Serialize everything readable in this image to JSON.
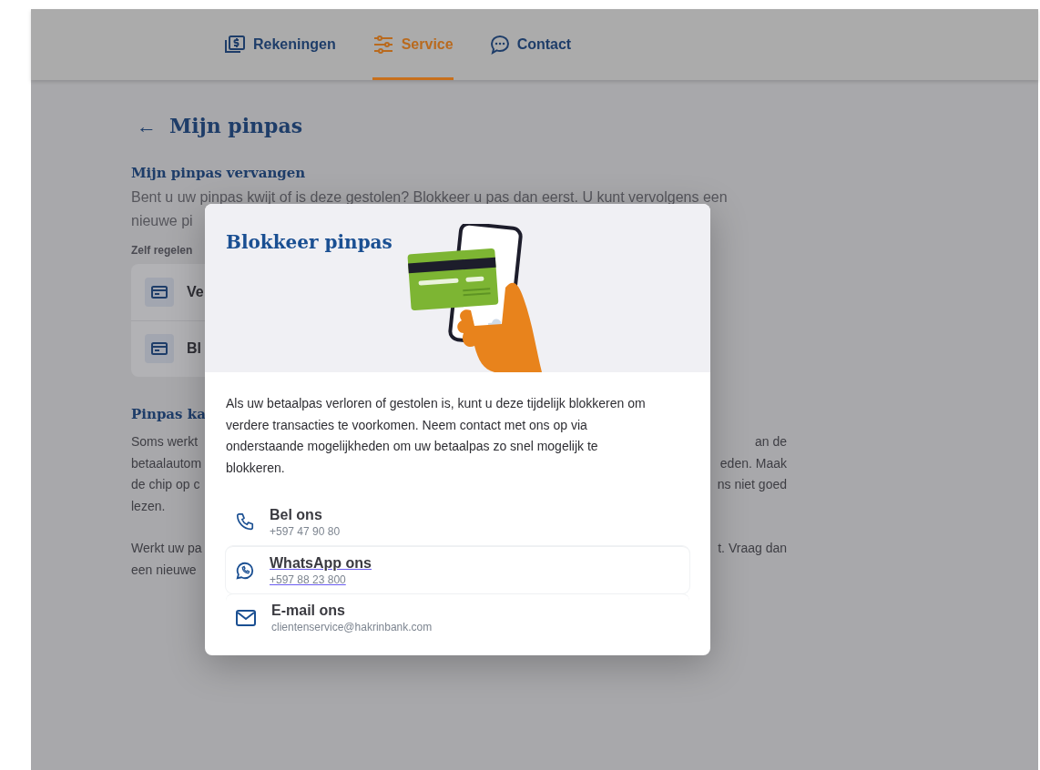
{
  "nav": {
    "tabs": [
      {
        "label": "Rekeningen",
        "kind": "accounts",
        "selected": false
      },
      {
        "label": "Service",
        "kind": "service",
        "selected": true
      },
      {
        "label": "Contact",
        "kind": "contact",
        "selected": false
      }
    ]
  },
  "page": {
    "back_arrow": "←",
    "title": "Mijn pinpas",
    "section_title": "Mijn pinpas vervangen",
    "intro_lines": [
      "Bent u uw pinpas kwijt of is deze gestolen? Blokkeer u pas dan eerst. U kunt vervolgens een",
      "nieuwe pi"
    ],
    "group_label": "Zelf regelen",
    "actions": [
      "Ve",
      "Bl"
    ],
    "section2_title": "Pinpas ka",
    "paragraphs": [
      [
        {
          "left": "Soms werkt",
          "right": "an de"
        },
        {
          "left": "betaalautom",
          "right": "eden. Maak"
        },
        {
          "left": "de chip op c",
          "right": "ns niet goed"
        },
        {
          "left": "lezen."
        }
      ],
      [
        {
          "left": "Werkt uw pa",
          "right": "t. Vraag dan"
        },
        {
          "left": "een nieuwe"
        }
      ]
    ]
  },
  "modal": {
    "title": "Blokkeer pinpas",
    "text": "Als uw betaalpas verloren of gestolen is, kunt u deze tijdelijk blokkeren om verdere transacties te voorkomen. Neem contact met ons op via onderstaande mogelijkheden om uw betaalpas zo snel mogelijk te blokkeren.",
    "contacts": [
      {
        "kind": "phone",
        "title": "Bel ons",
        "detail": "+597 47 90 80",
        "hovered": false
      },
      {
        "kind": "whatsapp",
        "title": "WhatsApp ons",
        "detail": "+597 88 23 800",
        "hovered": true
      },
      {
        "kind": "email",
        "title": "E-mail ons",
        "detail": "clientenservice@hakrinbank.com",
        "hovered": false
      }
    ]
  }
}
